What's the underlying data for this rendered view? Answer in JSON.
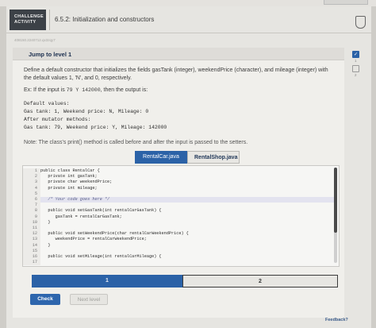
{
  "header": {
    "badge_line1": "CHALLENGE",
    "badge_line2": "ACTIVITY",
    "section_title": "6.5.2: Initialization and constructors"
  },
  "activity_id": "408150.2240712.qx3zqy7",
  "level": {
    "title": "Jump to level 1"
  },
  "instructions": "Define a default constructor that initializes the fields gasTank (integer), weekendPrice (character), and mileage (integer) with the default values 1, 'N', and 0, respectively.",
  "example": {
    "prefix": "Ex: If the input is",
    "input": "79 Y 142000",
    "suffix": ", then the output is:"
  },
  "output_lines": [
    "Default values:",
    "Gas tank: 1, Weekend price: N, Mileage: 0",
    "After mutator methods:",
    "Gas tank: 79, Weekend price: Y, Mileage: 142000"
  ],
  "note": "Note: The class's print() method is called before and after the input is passed to the setters.",
  "file_tabs": [
    "RentalCar.java",
    "RentalShop.java"
  ],
  "code_lines": [
    {
      "n": "1",
      "t": "public class RentalCar {"
    },
    {
      "n": "2",
      "t": "   private int gasTank;"
    },
    {
      "n": "3",
      "t": "   private char weekendPrice;"
    },
    {
      "n": "4",
      "t": "   private int mileage;"
    },
    {
      "n": "5",
      "t": ""
    },
    {
      "n": "6",
      "t": "   /* Your code goes here */"
    },
    {
      "n": "7",
      "t": ""
    },
    {
      "n": "8",
      "t": "   public void setGasTank(int rentalCarGasTank) {"
    },
    {
      "n": "9",
      "t": "      gasTank = rentalCarGasTank;"
    },
    {
      "n": "10",
      "t": "   }"
    },
    {
      "n": "11",
      "t": ""
    },
    {
      "n": "12",
      "t": "   public void setWeekendPrice(char rentalCarWeekendPrice) {"
    },
    {
      "n": "13",
      "t": "      weekendPrice = rentalCarWeekendPrice;"
    },
    {
      "n": "14",
      "t": "   }"
    },
    {
      "n": "15",
      "t": ""
    },
    {
      "n": "16",
      "t": "   public void setMileage(int rentalCarMileage) {"
    },
    {
      "n": "17",
      "t": ""
    }
  ],
  "progress": {
    "seg1": "1",
    "seg2": "2"
  },
  "buttons": {
    "check": "Check",
    "next": "Next level"
  },
  "side_levels": [
    "1",
    "2"
  ],
  "feedback": "Feedback?",
  "colors": {
    "accent": "#2b62a7",
    "badge": "#3c4147"
  }
}
